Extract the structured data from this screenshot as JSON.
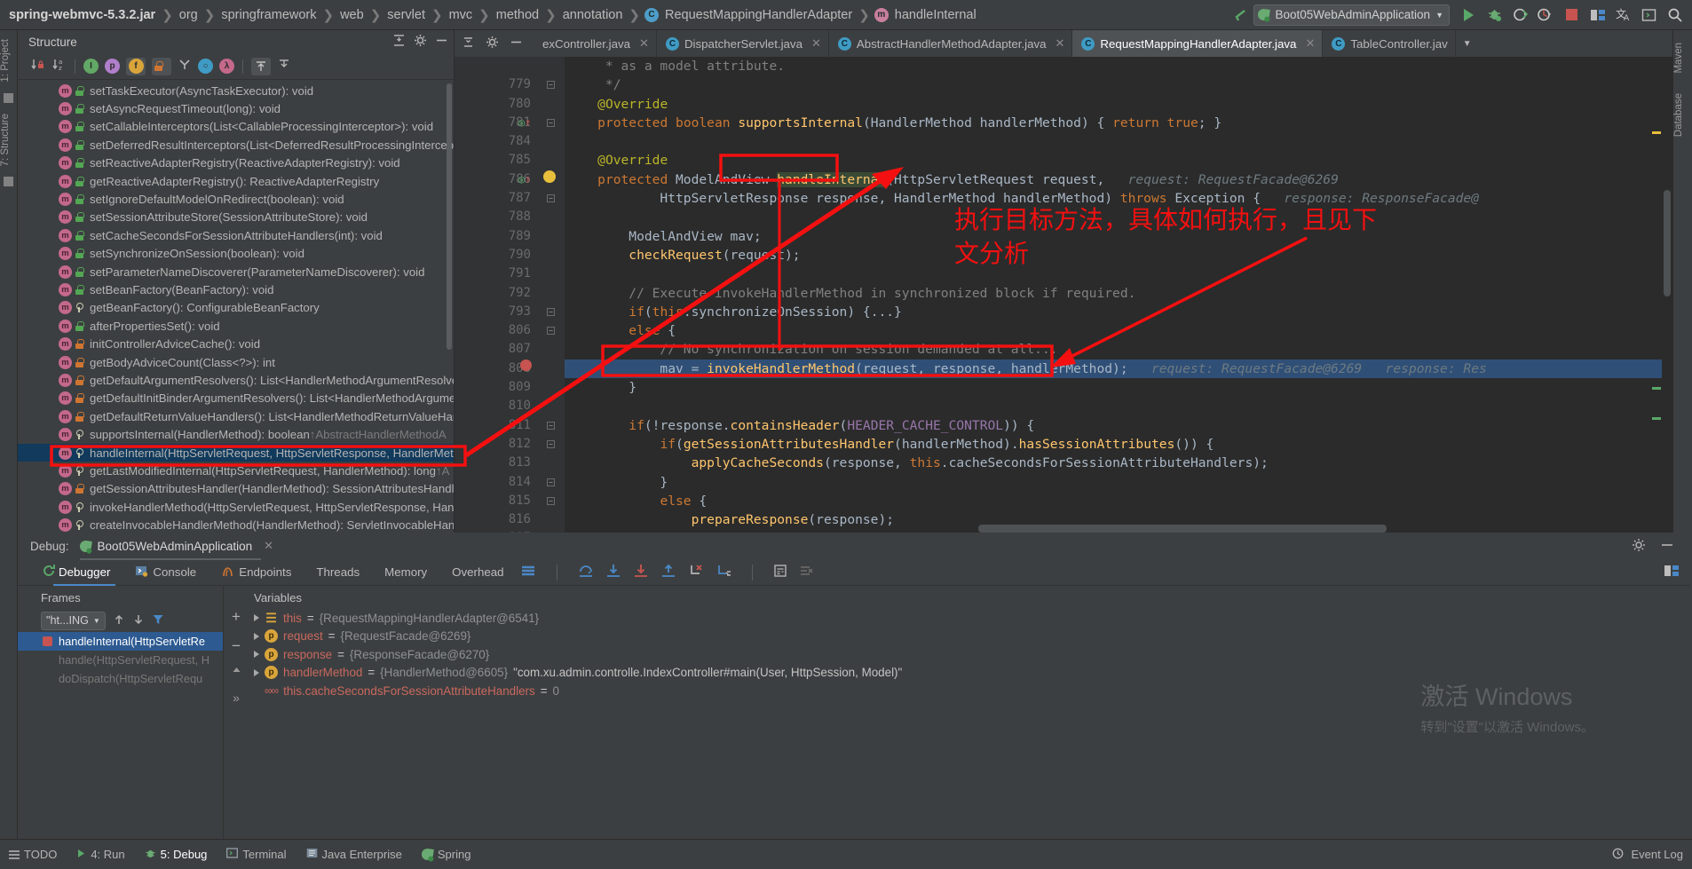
{
  "breadcrumb": {
    "items": [
      {
        "label": "spring-webmvc-5.3.2.jar",
        "icon": "",
        "bold": true
      },
      {
        "label": "org",
        "icon": ""
      },
      {
        "label": "springframework",
        "icon": ""
      },
      {
        "label": "web",
        "icon": ""
      },
      {
        "label": "servlet",
        "icon": ""
      },
      {
        "label": "mvc",
        "icon": ""
      },
      {
        "label": "method",
        "icon": ""
      },
      {
        "label": "annotation",
        "icon": ""
      },
      {
        "label": "RequestMappingHandlerAdapter",
        "icon": "class-icon"
      },
      {
        "label": "handleInternal",
        "icon": "method-icon"
      }
    ]
  },
  "toolbar": {
    "run_config": "Boot05WebAdminApplication",
    "run_config_icon": "spring-leaf-icon",
    "dropdown_icon": "chevron-down-icon",
    "buttons": [
      {
        "name": "run-button",
        "icon": "play-icon"
      },
      {
        "name": "debug-button",
        "icon": "bug-icon"
      },
      {
        "name": "run-with-coverage-button",
        "icon": "coverage-icon"
      },
      {
        "name": "profiler-button",
        "icon": "profiler-icon"
      },
      {
        "name": "stop-button",
        "icon": "stop-icon"
      },
      {
        "name": "layout-button",
        "icon": "layout-icon"
      },
      {
        "name": "translate-button",
        "icon": "translate-icon"
      },
      {
        "name": "terminal-button",
        "icon": "terminal-icon"
      },
      {
        "name": "search-everywhere-button",
        "icon": "search-icon"
      }
    ],
    "back_icon": "back-arrow-icon"
  },
  "left_strip": {
    "labels": [
      "1: Project",
      "7: Structure"
    ]
  },
  "right_strip": {
    "labels": [
      "Maven",
      "Database"
    ]
  },
  "structure": {
    "title": "Structure",
    "header_icons": [
      "expand-collapse-icon",
      "settings-icon",
      "hide-icon"
    ],
    "toolbar_icons": [
      "sort-by-visibility-icon",
      "sort-alphabetically-icon",
      "show-inherited-icon",
      "show-properties-icon",
      "show-fields-icon",
      "show-non-public-icon",
      "show-anonymous-icon",
      "show-interfaces-icon",
      "show-lambdas-icon",
      "expand-all-icon",
      "collapse-all-icon"
    ],
    "items": [
      {
        "label": "setTaskExecutor(AsyncTaskExecutor): void",
        "vis": "green"
      },
      {
        "label": "setAsyncRequestTimeout(long): void",
        "vis": "green"
      },
      {
        "label": "setCallableInterceptors(List<CallableProcessingInterceptor>): void",
        "vis": "green"
      },
      {
        "label": "setDeferredResultInterceptors(List<DeferredResultProcessingIntercept",
        "vis": "green"
      },
      {
        "label": "setReactiveAdapterRegistry(ReactiveAdapterRegistry): void",
        "vis": "green"
      },
      {
        "label": "getReactiveAdapterRegistry(): ReactiveAdapterRegistry",
        "vis": "green"
      },
      {
        "label": "setIgnoreDefaultModelOnRedirect(boolean): void",
        "vis": "green"
      },
      {
        "label": "setSessionAttributeStore(SessionAttributeStore): void",
        "vis": "green"
      },
      {
        "label": "setCacheSecondsForSessionAttributeHandlers(int): void",
        "vis": "green"
      },
      {
        "label": "setSynchronizeOnSession(boolean): void",
        "vis": "green"
      },
      {
        "label": "setParameterNameDiscoverer(ParameterNameDiscoverer): void",
        "vis": "green"
      },
      {
        "label": "setBeanFactory(BeanFactory): void",
        "vis": "green"
      },
      {
        "label": "getBeanFactory(): ConfigurableBeanFactory",
        "vis": "key"
      },
      {
        "label": "afterPropertiesSet(): void",
        "vis": "green"
      },
      {
        "label": "initControllerAdviceCache(): void",
        "vis": "orange"
      },
      {
        "label": "getBodyAdviceCount(Class<?>): int",
        "vis": "orange"
      },
      {
        "label": "getDefaultArgumentResolvers(): List<HandlerMethodArgumentResolve",
        "vis": "orange"
      },
      {
        "label": "getDefaultInitBinderArgumentResolvers(): List<HandlerMethodArgume",
        "vis": "orange"
      },
      {
        "label": "getDefaultReturnValueHandlers(): List<HandlerMethodReturnValueHan",
        "vis": "orange"
      },
      {
        "label": "supportsInternal(HandlerMethod): boolean",
        "vis": "key",
        "override": "↑AbstractHandlerMethodA"
      },
      {
        "label": "handleInternal(HttpServletRequest, HttpServletResponse, HandlerMeth",
        "vis": "key",
        "selected": true,
        "annotated": true
      },
      {
        "label": "getLastModifiedInternal(HttpServletRequest, HandlerMethod): long",
        "vis": "key",
        "override": "↑A"
      },
      {
        "label": "getSessionAttributesHandler(HandlerMethod): SessionAttributesHandl",
        "vis": "orange"
      },
      {
        "label": "invokeHandlerMethod(HttpServletRequest, HttpServletResponse, Han",
        "vis": "key"
      },
      {
        "label": "createInvocableHandlerMethod(HandlerMethod): ServletInvocableHan",
        "vis": "key"
      }
    ]
  },
  "editor": {
    "lead_icons": [
      "expand-collapse-icon",
      "settings-icon",
      "hide-icon"
    ],
    "tabs": [
      {
        "label": "exController.java",
        "icon": "",
        "active": false,
        "closable": true
      },
      {
        "label": "DispatcherServlet.java",
        "icon": "class-icon",
        "active": false,
        "closable": true
      },
      {
        "label": "AbstractHandlerMethodAdapter.java",
        "icon": "class-icon",
        "active": false,
        "closable": true
      },
      {
        "label": "RequestMappingHandlerAdapter.java",
        "icon": "class-icon",
        "active": true,
        "closable": true
      },
      {
        "label": "TableController.jav",
        "icon": "class-icon",
        "active": false,
        "closable": false
      }
    ],
    "tab_overflow_icon": "chevron-down-icon",
    "inspection_ok_icon": "checkmark-icon",
    "lines": [
      {
        "num": "",
        "text": "     * as a model attribute.",
        "kind": "comment-partial"
      },
      {
        "num": "779",
        "text": "     */",
        "kind": "comment",
        "fold": true
      },
      {
        "num": "780",
        "text": "    @Override",
        "kind": "annotation"
      },
      {
        "num": "781",
        "text": "    protected boolean supportsInternal(HandlerMethod handlerMethod) { return true; }",
        "kind": "code",
        "override": true,
        "fold": true
      },
      {
        "num": "784",
        "text": "",
        "kind": "code"
      },
      {
        "num": "785",
        "text": "    @Override",
        "kind": "annotation"
      },
      {
        "num": "786",
        "text": "    protected ModelAndView handleInternal(HttpServletRequest request,",
        "kind": "code",
        "override": true,
        "bulb": true,
        "hint": "request: RequestFacade@6269"
      },
      {
        "num": "787",
        "text": "            HttpServletResponse response, HandlerMethod handlerMethod) throws Exception {",
        "kind": "code",
        "hint": "response: ResponseFacade@",
        "fold": true
      },
      {
        "num": "788",
        "text": "",
        "kind": "code"
      },
      {
        "num": "789",
        "text": "        ModelAndView mav;",
        "kind": "code"
      },
      {
        "num": "790",
        "text": "        checkRequest(request);",
        "kind": "code"
      },
      {
        "num": "791",
        "text": "",
        "kind": "code"
      },
      {
        "num": "792",
        "text": "        // Execute invokeHandlerMethod in synchronized block if required.",
        "kind": "comment"
      },
      {
        "num": "793",
        "text": "        if (this.synchronizeOnSession) {...}",
        "kind": "code",
        "fold": true
      },
      {
        "num": "806",
        "text": "        else {",
        "kind": "code",
        "fold": true
      },
      {
        "num": "807",
        "text": "            // No synchronization on session demanded at all...",
        "kind": "comment"
      },
      {
        "num": "808",
        "text": "            mav = invokeHandlerMethod(request, response, handlerMethod);",
        "kind": "code",
        "executing": true,
        "hint": "request: RequestFacade@6269   response: Res"
      },
      {
        "num": "809",
        "text": "        }",
        "kind": "code"
      },
      {
        "num": "810",
        "text": "",
        "kind": "code"
      },
      {
        "num": "811",
        "text": "        if (!response.containsHeader(HEADER_CACHE_CONTROL)) {",
        "kind": "code",
        "fold": true
      },
      {
        "num": "812",
        "text": "            if (getSessionAttributesHandler(handlerMethod).hasSessionAttributes()) {",
        "kind": "code",
        "fold": true
      },
      {
        "num": "813",
        "text": "                applyCacheSeconds(response, this.cacheSecondsForSessionAttributeHandlers);",
        "kind": "code"
      },
      {
        "num": "814",
        "text": "            }",
        "kind": "code",
        "fold": true
      },
      {
        "num": "815",
        "text": "            else {",
        "kind": "code",
        "fold": true
      },
      {
        "num": "816",
        "text": "                prepareResponse(response);",
        "kind": "code"
      },
      {
        "num": "817",
        "text": "            }",
        "kind": "code"
      }
    ]
  },
  "annotations": {
    "note_line1": "执行目标方法，具体如何执行，且见下",
    "note_line2": "文分析",
    "note_color": "#f41010"
  },
  "debug": {
    "label": "Debug:",
    "config_name": "Boot05WebAdminApplication",
    "close_icon": "close-icon",
    "settings_icon": "gear-icon",
    "minimize_icon": "minimize-icon",
    "tabs": [
      {
        "label": "Debugger",
        "icon": "",
        "active": true
      },
      {
        "label": "Console",
        "icon": "console-icon",
        "active": false
      },
      {
        "label": "Endpoints",
        "icon": "endpoints-icon",
        "active": false
      },
      {
        "label": "Threads",
        "icon": "",
        "active": false
      },
      {
        "label": "Memory",
        "icon": "",
        "active": false
      },
      {
        "label": "Overhead",
        "icon": "",
        "active": false
      }
    ],
    "tool_icons": [
      "layout-settings-icon",
      "step-over-icon",
      "step-into-icon",
      "force-step-into-icon",
      "step-out-icon",
      "drop-frame-icon",
      "run-to-cursor-icon",
      "evaluate-expression-icon",
      "mute-breakpoints-icon"
    ],
    "restore_layout_icon": "restore-layout-icon",
    "rerun_icon": "rerun-icon",
    "frames": {
      "title": "Frames",
      "thread_selector": "\"ht...ING",
      "thread_dropdown_icon": "chevron-down-icon",
      "up_icon": "arrow-up-icon",
      "down_icon": "arrow-down-icon",
      "filter_icon": "filter-icon",
      "items": [
        {
          "label": "handleInternal(HttpServletRe",
          "selected": true,
          "breakpoint": true
        },
        {
          "label": "handle(HttpServletRequest, H",
          "selected": false
        },
        {
          "label": "doDispatch(HttpServletRequ",
          "selected": false
        }
      ]
    },
    "variables": {
      "title": "Variables",
      "add_icon": "plus-icon",
      "remove_icon": "minus-icon",
      "up_icon": "arrow-up-icon",
      "expand_icon": "chevron-right-icon",
      "items": [
        {
          "expander": true,
          "icon": "static-fields-icon",
          "name": "this",
          "eq": " = ",
          "value": "{RequestMappingHandlerAdapter@6541}",
          "str": ""
        },
        {
          "expander": true,
          "icon": "p",
          "name": "request",
          "eq": " = ",
          "value": "{RequestFacade@6269}",
          "str": ""
        },
        {
          "expander": true,
          "icon": "p",
          "name": "response",
          "eq": " = ",
          "value": "{ResponseFacade@6270}",
          "str": ""
        },
        {
          "expander": true,
          "icon": "p",
          "name": "handlerMethod",
          "eq": " = ",
          "value": "{HandlerMethod@6605}",
          "str": "\"com.xu.admin.controlle.IndexController#main(User, HttpSession, Model)\""
        },
        {
          "expander": false,
          "icon": "oo",
          "name": "this.cacheSecondsForSessionAttributeHandlers",
          "eq": " = ",
          "value": "0",
          "str": ""
        }
      ]
    }
  },
  "watermark": {
    "line1": "激活 Windows",
    "line2": "转到\"设置\"以激活 Windows。"
  },
  "statusbar": {
    "items": [
      {
        "label": "TODO",
        "icon": "todo-icon",
        "active": false
      },
      {
        "label": "4: Run",
        "icon": "run-icon",
        "active": false
      },
      {
        "label": "5: Debug",
        "icon": "debug-icon",
        "active": true
      },
      {
        "label": "Terminal",
        "icon": "terminal-icon",
        "active": false
      },
      {
        "label": "Java Enterprise",
        "icon": "java-enterprise-icon",
        "active": false
      },
      {
        "label": "Spring",
        "icon": "spring-icon",
        "active": false
      }
    ],
    "right": {
      "label": "Event Log",
      "icon": "event-log-icon"
    }
  }
}
